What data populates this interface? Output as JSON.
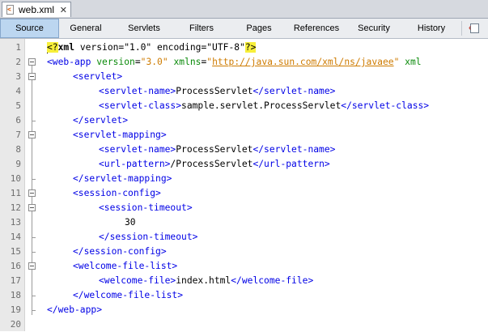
{
  "doc_tab": {
    "title": "web.xml",
    "close_glyph": "✕",
    "icon": "xml-file-icon"
  },
  "view_tabs": [
    {
      "label": "Source",
      "active": true
    },
    {
      "label": "General",
      "active": false
    },
    {
      "label": "Servlets",
      "active": false
    },
    {
      "label": "Filters",
      "active": false
    },
    {
      "label": "Pages",
      "active": false
    },
    {
      "label": "References",
      "active": false
    },
    {
      "label": "Security",
      "active": false
    },
    {
      "label": "History",
      "active": false
    }
  ],
  "toolbar": {
    "icon": "toggle-view-icon"
  },
  "editor": {
    "line_numbers": [
      "1",
      "2",
      "3",
      "4",
      "5",
      "6",
      "7",
      "8",
      "9",
      "10",
      "11",
      "12",
      "13",
      "14",
      "15",
      "16",
      "17",
      "18",
      "19",
      "20"
    ],
    "lines": {
      "l1": {
        "open": "<?",
        "name": "xml",
        "rest1": " version=\"1.0\" encoding=\"UTF-8\"",
        "close": "?>"
      },
      "l2": {
        "tag": "<web-app",
        "a1": " version",
        "eq1": "=",
        "v1": "\"3.0\"",
        "a2": " xmlns",
        "eq2": "=",
        "q1": "\"",
        "url": "http://java.sun.com/xml/ns/javaee",
        "q2": "\"",
        "a3": " xml"
      },
      "l3": {
        "tag": "<servlet>"
      },
      "l4": {
        "open": "<servlet-name>",
        "text": "ProcessServlet",
        "close": "</servlet-name>"
      },
      "l5": {
        "open": "<servlet-class>",
        "text": "sample.servlet.ProcessServlet",
        "close": "</servlet-class>"
      },
      "l6": {
        "tag": "</servlet>"
      },
      "l7": {
        "tag": "<servlet-mapping>"
      },
      "l8": {
        "open": "<servlet-name>",
        "text": "ProcessServlet",
        "close": "</servlet-name>"
      },
      "l9": {
        "open": "<url-pattern>",
        "text": "/ProcessServlet",
        "close": "</url-pattern>"
      },
      "l10": {
        "tag": "</servlet-mapping>"
      },
      "l11": {
        "tag": "<session-config>"
      },
      "l12": {
        "tag": "<session-timeout>"
      },
      "l13": {
        "text": "30"
      },
      "l14": {
        "tag": "</session-timeout>"
      },
      "l15": {
        "tag": "</session-config>"
      },
      "l16": {
        "tag": "<welcome-file-list>"
      },
      "l17": {
        "open": "<welcome-file>",
        "text": "index.html",
        "close": "</welcome-file>"
      },
      "l18": {
        "tag": "</welcome-file-list>"
      },
      "l19": {
        "tag": "</web-app>"
      },
      "l20": {
        "text": ""
      }
    }
  },
  "colors": {
    "tag": "#0000e6",
    "attribute": "#0a8a0a",
    "value": "#ce7b00",
    "declaration_highlight": "#f7ef3a",
    "active_tab": "#bcd6f0"
  }
}
